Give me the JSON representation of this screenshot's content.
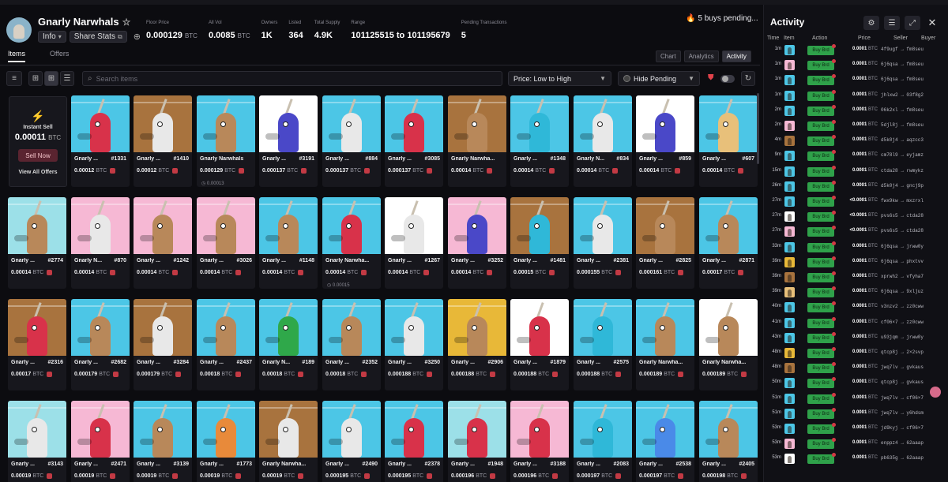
{
  "collection": {
    "name": "Gnarly Narwhals",
    "info_label": "Info",
    "share_label": "Share Stats"
  },
  "stats": [
    {
      "label": "Floor Price",
      "value": "0.000129",
      "unit": "BTC"
    },
    {
      "label": "All Vol",
      "value": "0.0085",
      "unit": "BTC"
    },
    {
      "label": "Owners",
      "value": "1K",
      "unit": ""
    },
    {
      "label": "Listed",
      "value": "364",
      "unit": ""
    },
    {
      "label": "Total Supply",
      "value": "4.9K",
      "unit": ""
    },
    {
      "label": "Range",
      "value": "101125515 to 101195679",
      "unit": ""
    },
    {
      "label": "Pending Transactions",
      "value": "5",
      "unit": ""
    }
  ],
  "pending_label": "5 buys pending...",
  "tabs": {
    "items": "Items",
    "offers": "Offers"
  },
  "view_tabs": {
    "chart": "Chart",
    "analytics": "Analytics",
    "activity": "Activity"
  },
  "toolbar": {
    "search_placeholder": "Search items",
    "sort": "Price: Low to High",
    "pending": "Hide Pending"
  },
  "instant_sell": {
    "label": "Instant Sell",
    "price": "0.00011",
    "unit": "BTC",
    "button": "Sell Now",
    "view_offers": "View All Offers"
  },
  "colors": {
    "buy_green": "#2fa14a",
    "accent_red": "#c23a44",
    "bg": "#0c0c10"
  },
  "cards": [
    {
      "name": "Gnarly ...",
      "num": "#1331",
      "price": "0.00012",
      "unit": "BTC",
      "sub": "",
      "bg": "#4cc6e6",
      "body": "#d8324a"
    },
    {
      "name": "Gnarly ...",
      "num": "#1410",
      "price": "0.00012",
      "unit": "BTC",
      "sub": "",
      "bg": "#a8733e",
      "body": "#e8e8e8"
    },
    {
      "name": "Gnarly Narwhals",
      "num": "",
      "price": "0.000129",
      "unit": "BTC",
      "sub": "0.00013",
      "bg": "#4cc6e6",
      "body": "#b8885a"
    },
    {
      "name": "Gnarly ...",
      "num": "#3191",
      "price": "0.000137",
      "unit": "BTC",
      "sub": "",
      "bg": "#ffffff",
      "body": "#4a48c8"
    },
    {
      "name": "Gnarly ...",
      "num": "#884",
      "price": "0.000137",
      "unit": "BTC",
      "sub": "",
      "bg": "#4cc6e6",
      "body": "#e8e8e8"
    },
    {
      "name": "Gnarly ...",
      "num": "#3085",
      "price": "0.000137",
      "unit": "BTC",
      "sub": "",
      "bg": "#4cc6e6",
      "body": "#d8324a"
    },
    {
      "name": "Gnarly Narwha...",
      "num": "",
      "price": "0.00014",
      "unit": "BTC",
      "sub": "",
      "bg": "#a8733e",
      "body": "#b8885a"
    },
    {
      "name": "Gnarly ...",
      "num": "#1348",
      "price": "0.00014",
      "unit": "BTC",
      "sub": "",
      "bg": "#4cc6e6",
      "body": "#2fb8d8"
    },
    {
      "name": "Gnarly N...",
      "num": "#834",
      "price": "0.00014",
      "unit": "BTC",
      "sub": "",
      "bg": "#4cc6e6",
      "body": "#e8e8e8"
    },
    {
      "name": "Gnarly ...",
      "num": "#859",
      "price": "0.00014",
      "unit": "BTC",
      "sub": "",
      "bg": "#ffffff",
      "body": "#4a48c8"
    },
    {
      "name": "Gnarly ...",
      "num": "#607",
      "price": "0.00014",
      "unit": "BTC",
      "sub": "",
      "bg": "#4cc6e6",
      "body": "#e8c07a"
    },
    {
      "name": "Gnarly ...",
      "num": "#2774",
      "price": "0.00014",
      "unit": "BTC",
      "sub": "",
      "bg": "#9ce0e8",
      "body": "#b8885a"
    },
    {
      "name": "Gnarly N...",
      "num": "#870",
      "price": "0.00014",
      "unit": "BTC",
      "sub": "",
      "bg": "#f6b8d4",
      "body": "#e8e8e8"
    },
    {
      "name": "Gnarly ...",
      "num": "#1242",
      "price": "0.00014",
      "unit": "BTC",
      "sub": "",
      "bg": "#f6b8d4",
      "body": "#b8885a"
    },
    {
      "name": "Gnarly ...",
      "num": "#3026",
      "price": "0.00014",
      "unit": "BTC",
      "sub": "",
      "bg": "#f6b8d4",
      "body": "#b8885a"
    },
    {
      "name": "Gnarly ...",
      "num": "#1148",
      "price": "0.00014",
      "unit": "BTC",
      "sub": "",
      "bg": "#4cc6e6",
      "body": "#b8885a"
    },
    {
      "name": "Gnarly Narwha...",
      "num": "",
      "price": "0.00014",
      "unit": "BTC",
      "sub": "0.00015",
      "bg": "#4cc6e6",
      "body": "#d8324a"
    },
    {
      "name": "Gnarly ...",
      "num": "#1267",
      "price": "0.00014",
      "unit": "BTC",
      "sub": "",
      "bg": "#ffffff",
      "body": "#e8e8e8"
    },
    {
      "name": "Gnarly ...",
      "num": "#3252",
      "price": "0.00014",
      "unit": "BTC",
      "sub": "",
      "bg": "#f6b8d4",
      "body": "#4a48c8"
    },
    {
      "name": "Gnarly ...",
      "num": "#1481",
      "price": "0.00015",
      "unit": "BTC",
      "sub": "",
      "bg": "#a8733e",
      "body": "#2fb8d8"
    },
    {
      "name": "Gnarly ...",
      "num": "#2381",
      "price": "0.000155",
      "unit": "BTC",
      "sub": "",
      "bg": "#4cc6e6",
      "body": "#e8e8e8"
    },
    {
      "name": "Gnarly ...",
      "num": "#2825",
      "price": "0.000161",
      "unit": "BTC",
      "sub": "",
      "bg": "#a8733e",
      "body": "#b8885a"
    },
    {
      "name": "Gnarly ...",
      "num": "#2871",
      "price": "0.00017",
      "unit": "BTC",
      "sub": "",
      "bg": "#4cc6e6",
      "body": "#b8885a"
    },
    {
      "name": "Gnarly ...",
      "num": "#2316",
      "price": "0.00017",
      "unit": "BTC",
      "sub": "",
      "bg": "#a8733e",
      "body": "#d8324a"
    },
    {
      "name": "Gnarly ...",
      "num": "#2682",
      "price": "0.000179",
      "unit": "BTC",
      "sub": "",
      "bg": "#4cc6e6",
      "body": "#b8885a"
    },
    {
      "name": "Gnarly ...",
      "num": "#3284",
      "price": "0.000179",
      "unit": "BTC",
      "sub": "",
      "bg": "#a8733e",
      "body": "#e8e8e8"
    },
    {
      "name": "Gnarly ...",
      "num": "#2437",
      "price": "0.00018",
      "unit": "BTC",
      "sub": "",
      "bg": "#4cc6e6",
      "body": "#b8885a"
    },
    {
      "name": "Gnarly N...",
      "num": "#189",
      "price": "0.00018",
      "unit": "BTC",
      "sub": "",
      "bg": "#4cc6e6",
      "body": "#2fa84a"
    },
    {
      "name": "Gnarly ...",
      "num": "#2352",
      "price": "0.00018",
      "unit": "BTC",
      "sub": "",
      "bg": "#4cc6e6",
      "body": "#b8885a"
    },
    {
      "name": "Gnarly ...",
      "num": "#3250",
      "price": "0.000188",
      "unit": "BTC",
      "sub": "",
      "bg": "#4cc6e6",
      "body": "#e8e8e8"
    },
    {
      "name": "Gnarly ...",
      "num": "#2906",
      "price": "0.000188",
      "unit": "BTC",
      "sub": "",
      "bg": "#e8b838",
      "body": "#b8885a"
    },
    {
      "name": "Gnarly ...",
      "num": "#1879",
      "price": "0.000188",
      "unit": "BTC",
      "sub": "",
      "bg": "#ffffff",
      "body": "#d8324a"
    },
    {
      "name": "Gnarly ...",
      "num": "#2575",
      "price": "0.000188",
      "unit": "BTC",
      "sub": "",
      "bg": "#4cc6e6",
      "body": "#2fb8d8"
    },
    {
      "name": "Gnarly Narwha...",
      "num": "",
      "price": "0.000189",
      "unit": "BTC",
      "sub": "",
      "bg": "#4cc6e6",
      "body": "#b8885a"
    },
    {
      "name": "Gnarly Narwha...",
      "num": "",
      "price": "0.000189",
      "unit": "BTC",
      "sub": "",
      "bg": "#ffffff",
      "body": "#b8885a"
    },
    {
      "name": "Gnarly ...",
      "num": "#3143",
      "price": "0.00019",
      "unit": "BTC",
      "sub": "",
      "bg": "#9ce0e8",
      "body": "#e8e8e8"
    },
    {
      "name": "Gnarly ...",
      "num": "#2471",
      "price": "0.00019",
      "unit": "BTC",
      "sub": "",
      "bg": "#f6b8d4",
      "body": "#d8324a"
    },
    {
      "name": "Gnarly ...",
      "num": "#3139",
      "price": "0.00019",
      "unit": "BTC",
      "sub": "",
      "bg": "#4cc6e6",
      "body": "#b8885a"
    },
    {
      "name": "Gnarly ...",
      "num": "#1773",
      "price": "0.00019",
      "unit": "BTC",
      "sub": "",
      "bg": "#4cc6e6",
      "body": "#e88a3a"
    },
    {
      "name": "Gnarly Narwha...",
      "num": "",
      "price": "0.00019",
      "unit": "BTC",
      "sub": "",
      "bg": "#a8733e",
      "body": "#e8e8e8"
    },
    {
      "name": "Gnarly ...",
      "num": "#2490",
      "price": "0.000195",
      "unit": "BTC",
      "sub": "",
      "bg": "#4cc6e6",
      "body": "#e8e8e8"
    },
    {
      "name": "Gnarly ...",
      "num": "#2378",
      "price": "0.000195",
      "unit": "BTC",
      "sub": "",
      "bg": "#4cc6e6",
      "body": "#d8324a"
    },
    {
      "name": "Gnarly ...",
      "num": "#1948",
      "price": "0.000196",
      "unit": "BTC",
      "sub": "",
      "bg": "#9ce0e8",
      "body": "#d8324a"
    },
    {
      "name": "Gnarly ...",
      "num": "#3188",
      "price": "0.000196",
      "unit": "BTC",
      "sub": "",
      "bg": "#f6b8d4",
      "body": "#d8324a"
    },
    {
      "name": "Gnarly ...",
      "num": "#2083",
      "price": "0.000197",
      "unit": "BTC",
      "sub": "",
      "bg": "#4cc6e6",
      "body": "#2fb8d8"
    },
    {
      "name": "Gnarly ...",
      "num": "#2538",
      "price": "0.000197",
      "unit": "BTC",
      "sub": "",
      "bg": "#4cc6e6",
      "body": "#4a8ae8"
    },
    {
      "name": "Gnarly ...",
      "num": "#2405",
      "price": "0.000198",
      "unit": "BTC",
      "sub": "",
      "bg": "#4cc6e6",
      "body": "#b8885a"
    }
  ],
  "activity": {
    "title": "Activity",
    "columns": {
      "time": "Time",
      "item": "Item",
      "action": "Action",
      "price": "Price",
      "seller": "Seller",
      "buyer": "Buyer"
    },
    "rows": [
      {
        "time": "1m",
        "action": "Buy Brd",
        "price": "0.0001",
        "unit": "BTC",
        "tx": "4f9ugf → fm8seu",
        "thumb": "#4cc6e6"
      },
      {
        "time": "1m",
        "action": "Buy Brd",
        "price": "0.0001",
        "unit": "BTC",
        "tx": "6j6qsa → fm8seu",
        "thumb": "#f6b8d4"
      },
      {
        "time": "1m",
        "action": "Buy Brd",
        "price": "0.0001",
        "unit": "BTC",
        "tx": "6j6qsa → fm8seu",
        "thumb": "#4cc6e6"
      },
      {
        "time": "1m",
        "action": "Buy Brd",
        "price": "0.0001",
        "unit": "BTC",
        "tx": "jhlxw2 → 03f8g2",
        "thumb": "#4cc6e6"
      },
      {
        "time": "2m",
        "action": "Buy Brd",
        "price": "0.0001",
        "unit": "BTC",
        "tx": "06k2xl → fm8seu",
        "thumb": "#4cc6e6"
      },
      {
        "time": "2m",
        "action": "Buy Brd",
        "price": "0.0001",
        "unit": "BTC",
        "tx": "5djl8j → fm8seu",
        "thumb": "#f6b8d4"
      },
      {
        "time": "4m",
        "action": "Buy Brd",
        "price": "0.0001",
        "unit": "BTC",
        "tx": "d5k0j4 → aqzcc3",
        "thumb": "#a8733e"
      },
      {
        "time": "9m",
        "action": "Buy Brd",
        "price": "0.0001",
        "unit": "BTC",
        "tx": "cm78l9 → eyjamz",
        "thumb": "#4cc6e6"
      },
      {
        "time": "15m",
        "action": "Buy Brd",
        "price": "0.0001",
        "unit": "BTC",
        "tx": "ctda28 → rwmykz",
        "thumb": "#4cc6e6"
      },
      {
        "time": "26m",
        "action": "Buy Brd",
        "price": "0.0001",
        "unit": "BTC",
        "tx": "d5k0j4 → gncj9p",
        "thumb": "#4cc6e6"
      },
      {
        "time": "27m",
        "action": "Buy Brd",
        "price": "<0.0001",
        "unit": "BTC",
        "tx": "fwx9kw → mxzrxl",
        "thumb": "#4cc6e6"
      },
      {
        "time": "27m",
        "action": "Buy Brd",
        "price": "<0.0001",
        "unit": "BTC",
        "tx": "pvs6s5 → ctda28",
        "thumb": "#ffffff"
      },
      {
        "time": "27m",
        "action": "Buy Brd",
        "price": "<0.0001",
        "unit": "BTC",
        "tx": "pvs6s5 → ctda28",
        "thumb": "#f6b8d4"
      },
      {
        "time": "33m",
        "action": "Buy Brd",
        "price": "0.0001",
        "unit": "BTC",
        "tx": "6j6qsa → jrww0y",
        "thumb": "#4cc6e6"
      },
      {
        "time": "39m",
        "action": "Buy Brd",
        "price": "0.0001",
        "unit": "BTC",
        "tx": "6j6qsa → phxtvv",
        "thumb": "#e8b838"
      },
      {
        "time": "39m",
        "action": "Buy Brd",
        "price": "0.0001",
        "unit": "BTC",
        "tx": "xprwh2 → vfyha7",
        "thumb": "#a8733e"
      },
      {
        "time": "39m",
        "action": "Buy Brd",
        "price": "0.0001",
        "unit": "BTC",
        "tx": "6j6qsa → 9xljuz",
        "thumb": "#e8c07a"
      },
      {
        "time": "40m",
        "action": "Buy Brd",
        "price": "0.0001",
        "unit": "BTC",
        "tx": "v3nzv2 → zz0cww",
        "thumb": "#4cc6e6"
      },
      {
        "time": "41m",
        "action": "Buy Brd",
        "price": "0.0001",
        "unit": "BTC",
        "tx": "cf06×7 → zz0cww",
        "thumb": "#4cc6e6"
      },
      {
        "time": "43m",
        "action": "Buy Brd",
        "price": "0.0001",
        "unit": "BTC",
        "tx": "u93jqm → jrww0y",
        "thumb": "#4cc6e6"
      },
      {
        "time": "48m",
        "action": "Buy Brd",
        "price": "0.0001",
        "unit": "BTC",
        "tx": "qtcp8j → 2×2svp",
        "thumb": "#e8b838"
      },
      {
        "time": "48m",
        "action": "Buy Brd",
        "price": "0.0001",
        "unit": "BTC",
        "tx": "jwq7lv → gvkaus",
        "thumb": "#a8733e"
      },
      {
        "time": "50m",
        "action": "Buy Brd",
        "price": "0.0001",
        "unit": "BTC",
        "tx": "qtcp8j → gvkaus",
        "thumb": "#4cc6e6"
      },
      {
        "time": "51m",
        "action": "Buy Brd",
        "price": "0.0001",
        "unit": "BTC",
        "tx": "jwq7lv → cf06×7",
        "thumb": "#4cc6e6"
      },
      {
        "time": "51m",
        "action": "Buy Brd",
        "price": "0.0001",
        "unit": "BTC",
        "tx": "jwq7lv → y6hdsm",
        "thumb": "#4cc6e6"
      },
      {
        "time": "53m",
        "action": "Buy Brd",
        "price": "0.0001",
        "unit": "BTC",
        "tx": "jd9kyj → cf06×7",
        "thumb": "#4cc6e6"
      },
      {
        "time": "53m",
        "action": "Buy Brd",
        "price": "0.0001",
        "unit": "BTC",
        "tx": "enppz4 → 62aaap",
        "thumb": "#f6b8d4"
      },
      {
        "time": "53m",
        "action": "Buy Brd",
        "price": "0.0001",
        "unit": "BTC",
        "tx": "pb635g → 62aaap",
        "thumb": "#ffffff"
      }
    ]
  }
}
